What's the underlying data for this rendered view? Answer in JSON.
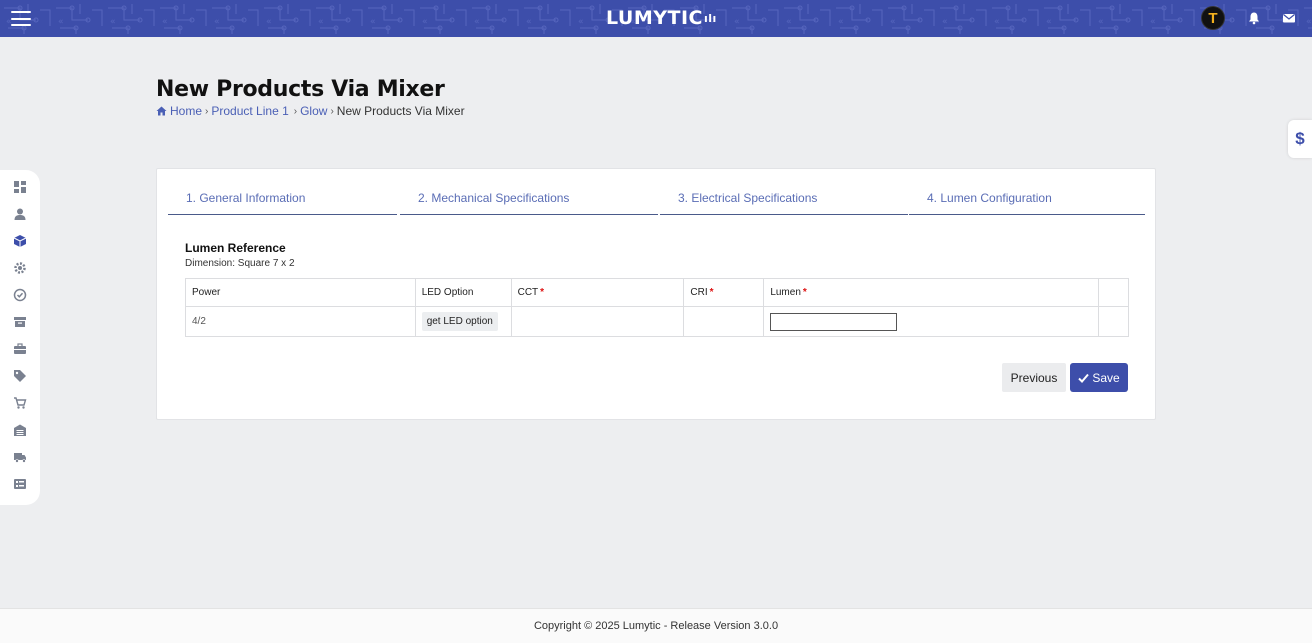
{
  "header": {
    "brand": "LUMYTIC",
    "avatar_letter": "T",
    "accent_color": "#3d4eaa",
    "icons": [
      "menu-icon",
      "bell-icon",
      "mail-icon"
    ]
  },
  "sidebar": {
    "icons": [
      "dashboard-icon",
      "user-icon",
      "cube-icon",
      "gear-icon",
      "check-circle-icon",
      "archive-icon",
      "briefcase-icon",
      "tag-icon",
      "cart-icon",
      "warehouse-icon",
      "truck-icon",
      "list-icon"
    ]
  },
  "pricing_tab": {
    "label": "$"
  },
  "page": {
    "title": "New Products Via Mixer",
    "breadcrumb": [
      "Home",
      "Product Line 1",
      "Glow",
      "New Products Via Mixer"
    ]
  },
  "steps": [
    {
      "label": "1. General Information"
    },
    {
      "label": "2. Mechanical Specifications"
    },
    {
      "label": "3. Electrical Specifications"
    },
    {
      "label": "4. Lumen Configuration"
    }
  ],
  "section": {
    "title": "Lumen Reference",
    "subtitle": "Dimension: Square 7 x 2"
  },
  "table": {
    "headers": [
      "Power",
      "LED Option",
      "CCT",
      "CRI",
      "Lumen",
      ""
    ],
    "required_marker": "*",
    "rows": [
      {
        "power": "4/2",
        "led_button": "get LED option",
        "cct": "",
        "cri": "",
        "lumen": ""
      }
    ]
  },
  "actions": {
    "previous": "Previous",
    "save": "Save"
  },
  "footer": {
    "text": "Copyright © 2025 Lumytic - Release Version 3.0.0"
  }
}
